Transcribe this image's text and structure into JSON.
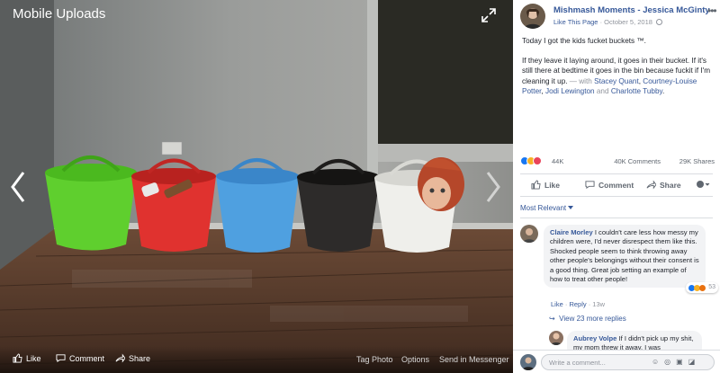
{
  "viewer": {
    "album_title": "Mobile Uploads",
    "actions": {
      "like": "Like",
      "comment": "Comment",
      "share": "Share"
    },
    "right_links": {
      "tag_photo": "Tag Photo",
      "options": "Options",
      "send_messenger": "Send in Messenger"
    }
  },
  "post": {
    "author": "Mishmash Moments - Jessica McGinty",
    "like_page": "Like This Page",
    "sep": " · ",
    "date": "October 5, 2018",
    "text_p1": "Today I got the kids fucket buckets ™.",
    "text_p2": "If they leave it laying around, it goes in their bucket. If it's still there at bedtime it goes in the bin because fuckit if I'm cleaning it up.",
    "with_prefix": " — with ",
    "tag1": "Stacey Quant",
    "comma1": ", ",
    "tag2": "Courtney-Louise Potter",
    "comma2": ", ",
    "tag3": "Jodi Lewington",
    "and_text": " and ",
    "tag4": "Charlotte Tubby",
    "period": "."
  },
  "stats": {
    "reactions": "44K",
    "comments": "40K Comments",
    "shares": "29K Shares",
    "reaction_colors": [
      "#1877f2",
      "#f7b125",
      "#e9445a"
    ]
  },
  "action_bar": {
    "like": "Like",
    "comment": "Comment",
    "share": "Share"
  },
  "sort": {
    "label": "Most Relevant"
  },
  "comments": [
    {
      "name": "Claire Morley",
      "text": "I couldn't care less how messy my children were, I'd never disrespect them like this. Shocked people seem to think throwing away other people's belongings without their consent is a good thing. Great job setting an example of how to treat other people!",
      "like": "Like",
      "reply": "Reply",
      "time": "13w",
      "reaction_count": "53"
    },
    {
      "name": "Aubrey Volpe",
      "text": "If I didn't pick up my shit, my mom threw it away. I was"
    }
  ],
  "view_replies": "View 23 more replies",
  "comment_box": {
    "placeholder": "Write a comment..."
  }
}
